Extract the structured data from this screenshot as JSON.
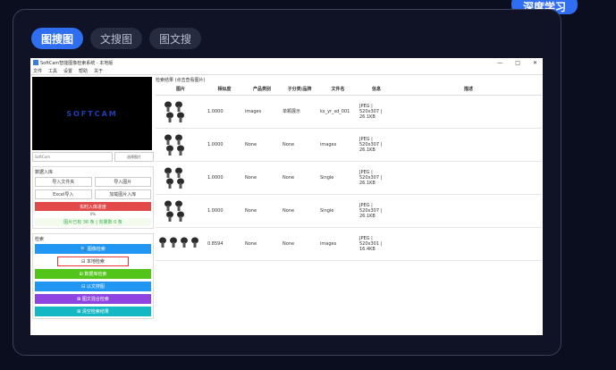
{
  "corner_badge": "深度学习",
  "tabs": [
    {
      "label": "图搜图",
      "active": true
    },
    {
      "label": "文搜图",
      "active": false
    },
    {
      "label": "图文搜",
      "active": false
    }
  ],
  "window": {
    "title": "SoftCam智能图像检索系统 - 本地版",
    "controls": [
      "—",
      "□",
      "✕"
    ],
    "menu": [
      "文件",
      "工具",
      "设置",
      "帮助",
      "关于"
    ]
  },
  "left": {
    "preview_brand": "SOFTCAM",
    "path_placeholder": "SoftCam",
    "path_button": "选择图片",
    "import_group": {
      "title": "数据入库",
      "buttons": [
        "导入文件夹",
        "导入图片",
        "Excel导入",
        "加载图片入库"
      ],
      "progress_bar": "实时入库进度",
      "percent": "0%",
      "status": "图片已有 36 条 | 向量数 0 条"
    },
    "search_group": {
      "title": "检索",
      "buttons": [
        {
          "label": "🔍 图像检索",
          "color": "#2196f3"
        },
        {
          "label": "⊟ 本地检索",
          "color": "#ffffff"
        },
        {
          "label": "⊞ 数据库检索",
          "color": "#52c41a"
        },
        {
          "label": "⊟ 以文搜图",
          "color": "#2196f3"
        },
        {
          "label": "⊠ 图文混合检索",
          "color": "#8e44e0"
        },
        {
          "label": "⊠ 清空检索结果",
          "color": "#14b8c4"
        }
      ]
    }
  },
  "right": {
    "title": "检索结果 (点击查看图片)",
    "columns": [
      "图片",
      "相似度",
      "产品类别",
      "子分类/品牌",
      "文件名",
      "信息",
      "描述"
    ],
    "rows": [
      {
        "sim": "1.0000",
        "cat": "images",
        "sub": "单颗展示",
        "file": "ks_yr_sd_001",
        "info": [
          "JPEG |",
          "520x307 |",
          "26.1KB"
        ],
        "desc": ""
      },
      {
        "sim": "1.0000",
        "cat": "None",
        "sub": "None",
        "file": "images",
        "info": [
          "JPEG |",
          "520x307 |",
          "26.1KB"
        ],
        "desc": ""
      },
      {
        "sim": "1.0000",
        "cat": "None",
        "sub": "None",
        "file": "Single",
        "info": [
          "JPEG |",
          "520x307 |",
          "26.1KB"
        ],
        "desc": ""
      },
      {
        "sim": "1.0000",
        "cat": "None",
        "sub": "None",
        "file": "Single",
        "info": [
          "JPEG |",
          "520x307 |",
          "26.1KB"
        ],
        "desc": ""
      },
      {
        "sim": "0.8594",
        "cat": "None",
        "sub": "None",
        "file": "images",
        "info": [
          "JPEG |",
          "520x301 |",
          "16.4KB"
        ],
        "desc": ""
      }
    ]
  }
}
